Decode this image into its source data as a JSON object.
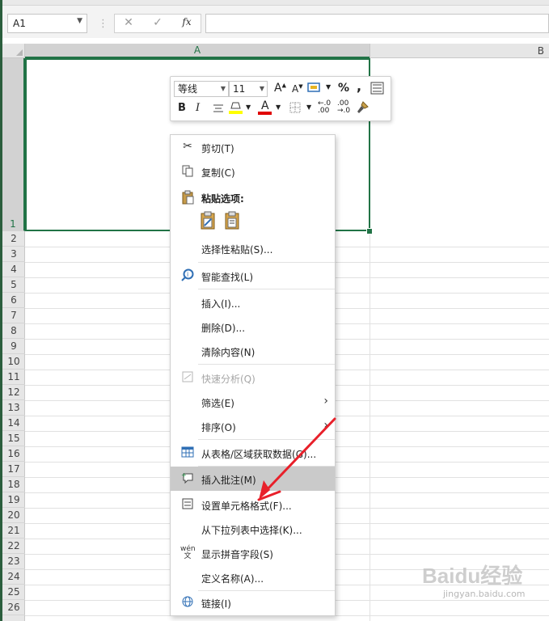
{
  "formula_bar": {
    "name_box": "A1",
    "cancel_icon": "✕",
    "enter_icon": "✓",
    "fx_label": "fx",
    "formula_value": ""
  },
  "columns": [
    "A",
    "B"
  ],
  "rows": [
    "1",
    "2",
    "3",
    "4",
    "5",
    "6",
    "7",
    "8",
    "9",
    "10",
    "11",
    "12",
    "13",
    "14",
    "15",
    "16",
    "17",
    "18",
    "19",
    "20",
    "21",
    "22",
    "23",
    "24",
    "25",
    "26"
  ],
  "mini_toolbar": {
    "font_name": "等线",
    "font_size": "11",
    "bold": "B",
    "italic": "I",
    "percent": "%",
    "comma": ",",
    "grow_font": "A",
    "shrink_font": "A",
    "font_color_letter": "A",
    "dec_increase": ".00",
    "dec_decrease": ".00",
    "colors": {
      "fill": "#ffff00",
      "font": "#e00000"
    }
  },
  "context_menu": {
    "items": [
      {
        "label": "剪切(T)",
        "icon": "scissors-icon",
        "disabled": false
      },
      {
        "label": "复制(C)",
        "icon": "copy-icon",
        "disabled": false
      },
      {
        "label": "粘贴选项:",
        "icon": "paste-icon",
        "disabled": false
      },
      {
        "label": "选择性粘贴(S)...",
        "icon": "",
        "disabled": false
      },
      {
        "label": "智能查找(L)",
        "icon": "smart-lookup-icon",
        "disabled": false
      },
      {
        "label": "插入(I)...",
        "icon": "",
        "disabled": false
      },
      {
        "label": "删除(D)...",
        "icon": "",
        "disabled": false
      },
      {
        "label": "清除内容(N)",
        "icon": "",
        "disabled": false
      },
      {
        "label": "快速分析(Q)",
        "icon": "quick-analysis-icon",
        "disabled": true
      },
      {
        "label": "筛选(E)",
        "icon": "",
        "disabled": false
      },
      {
        "label": "排序(O)",
        "icon": "",
        "disabled": false
      },
      {
        "label": "从表格/区域获取数据(G)...",
        "icon": "table-icon",
        "disabled": false
      },
      {
        "label": "插入批注(M)",
        "icon": "comment-icon",
        "disabled": false
      },
      {
        "label": "设置单元格格式(F)...",
        "icon": "format-cells-icon",
        "disabled": false
      },
      {
        "label": "从下拉列表中选择(K)...",
        "icon": "",
        "disabled": false
      },
      {
        "label": "显示拼音字段(S)",
        "icon": "phonetic-icon",
        "disabled": false
      },
      {
        "label": "定义名称(A)...",
        "icon": "",
        "disabled": false
      },
      {
        "label": "链接(I)",
        "icon": "link-icon",
        "disabled": false
      }
    ]
  },
  "annotation": {
    "arrow_color": "#e8202a"
  },
  "watermark": {
    "brand": "Baidu经验",
    "url": "jingyan.baidu.com"
  }
}
